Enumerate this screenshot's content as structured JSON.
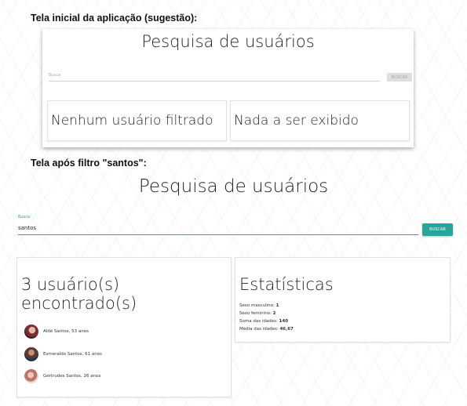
{
  "captions": {
    "initial": "Tela inicial da aplicação (sugestão):",
    "filtered": "Tela após filtro \"santos\":"
  },
  "initial_screen": {
    "title": "Pesquisa de usuários",
    "search": {
      "label": "Busca",
      "value": ""
    },
    "button_label": "BUSCAR",
    "left_card_text": "Nenhum usuário filtrado",
    "right_card_text": "Nada a ser exibido"
  },
  "filtered_screen": {
    "title": "Pesquisa de usuários",
    "search": {
      "label": "Busca",
      "value": "santos"
    },
    "button_label": "BUSCAR",
    "users_card": {
      "title": "3 usuário(s) encontrado(s)",
      "users": [
        {
          "text": "Aldé Santos, 53 anos"
        },
        {
          "text": "Esmeraldo Santos, 61 anos"
        },
        {
          "text": "Gertrudes Santos, 26 anos"
        }
      ]
    },
    "stats_card": {
      "title": "Estatísticas",
      "items": [
        {
          "label": "Sexo masculino:",
          "value": "1"
        },
        {
          "label": "Sexo feminino:",
          "value": "2"
        },
        {
          "label": "Soma das idades:",
          "value": "140"
        },
        {
          "label": "Média das idades:",
          "value": "46,67"
        }
      ]
    }
  },
  "colors": {
    "accent": "#26a69a",
    "disabled_button": "#dfdfdf"
  }
}
